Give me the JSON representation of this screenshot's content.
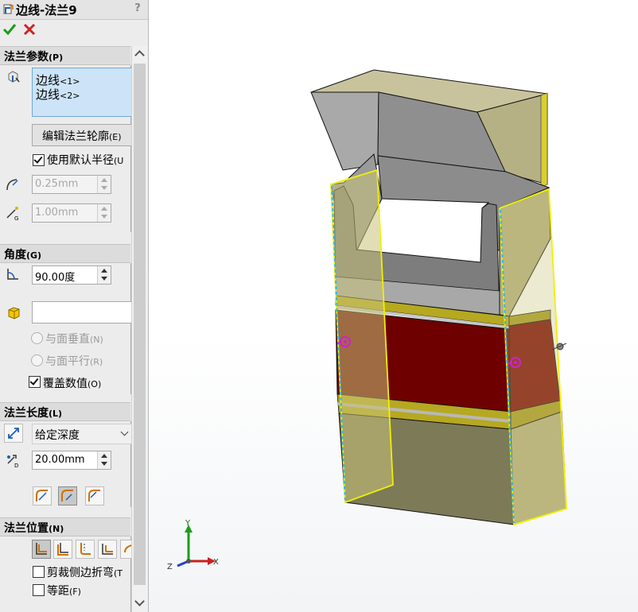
{
  "title": "边线-法兰9",
  "help": "?",
  "colors": {
    "accent_green": "#1a9e1a",
    "cancel_red": "#d42020",
    "selection_box": "#cde4f8",
    "edge_highlight": "#f0f000",
    "red_band": "#6e0000",
    "box_face": "#b6b184"
  },
  "flange_params": {
    "header": "法兰参数",
    "header_key": "(P)",
    "edges": [
      "边线",
      "边线"
    ],
    "edge_nums": [
      "<1>",
      "<2>"
    ],
    "edit_profile": "编辑法兰轮廓",
    "edit_profile_key": "(E)",
    "use_default_radius": "使用默认半径",
    "use_default_radius_key": "(U",
    "use_default_radius_checked": true,
    "radius": "0.25mm",
    "gap": "1.00mm"
  },
  "angle": {
    "header": "角度",
    "header_key": "(G)",
    "value": "90.00度",
    "face_input": "",
    "normal_to_face": "与面垂直",
    "normal_to_face_key": "(N)",
    "parallel_to_face": "与面平行",
    "parallel_to_face_key": "(R)",
    "override": "覆盖数值",
    "override_key": "(O)",
    "override_checked": true
  },
  "length": {
    "header": "法兰长度",
    "header_key": "(L)",
    "end_condition": "给定深度",
    "depth": "20.00mm"
  },
  "position": {
    "header": "法兰位置",
    "header_key": "(N)",
    "trim_side_bends": "剪裁侧边折弯",
    "trim_side_bends_key": "(T",
    "trim_checked": false,
    "offset": "等距",
    "offset_key": "(F)",
    "offset_checked": false
  },
  "triad": {
    "x": "X",
    "y": "Y",
    "z": "Z"
  },
  "icons": [
    "edge-flange-icon",
    "confirm-check-icon",
    "cancel-x-icon",
    "edge-select-icon",
    "bend-radius-icon",
    "gap-icon",
    "angle-icon",
    "face-select-icon",
    "reverse-direction-icon",
    "depth-icon",
    "length-outer-icon",
    "length-inner-icon",
    "length-tangent-icon",
    "material-inside-icon",
    "material-outside-icon",
    "bend-outside-icon",
    "virtual-sharp-icon",
    "bend-from-virtual-icon",
    "weld-point-icon",
    "collapse-arrow-icon"
  ]
}
